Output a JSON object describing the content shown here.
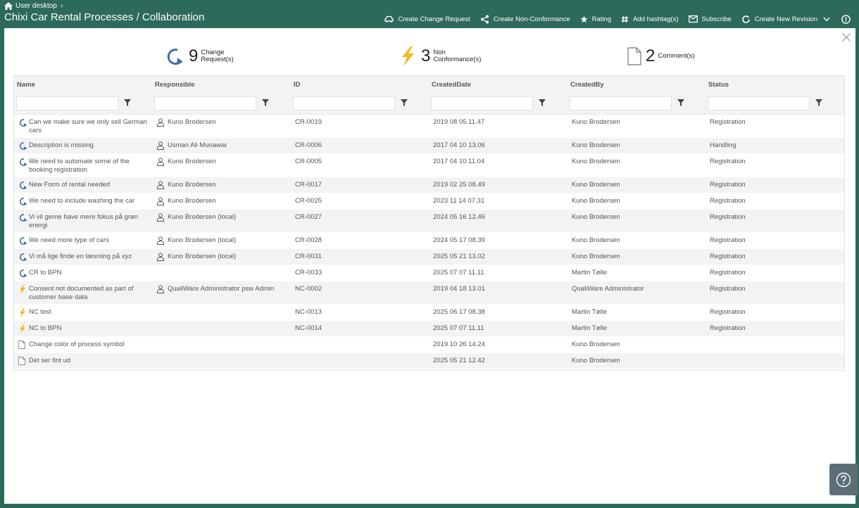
{
  "breadcrumb": {
    "label": "User desktop"
  },
  "title": "Chixi Car Rental Processes / Collaboration",
  "toolbar": {
    "create_change_request": "Create Change Request",
    "create_non_conformance": "Create Non-Conformance",
    "rating": "Rating",
    "add_hashtag": "Add hashtag(s)",
    "subscribe": "Subscribe",
    "create_new_revision": "Create New Revision"
  },
  "summary": {
    "change_requests": {
      "count": "9",
      "label_line1": "Change",
      "label_line2": "Request(s)"
    },
    "non_conformances": {
      "count": "3",
      "label_line1": "Non",
      "label_line2": "Conformance(s)"
    },
    "comments": {
      "count": "2",
      "label": "Comment(s)"
    }
  },
  "columns": {
    "name": "Name",
    "responsible": "Responsible",
    "id": "ID",
    "created_date": "CreatedDate",
    "created_by": "CreatedBy",
    "status": "Status"
  },
  "rows": [
    {
      "type": "change-request",
      "name": "Can we make sure we only sell German cars",
      "responsible": "Kuno Brodersen",
      "id": "CR-0019",
      "date": "2019 08 05 11.47",
      "by": "Kuno Brodersen",
      "status": "Registration"
    },
    {
      "type": "change-request",
      "name": "Description is missing",
      "responsible": "Usman Ali Munawar",
      "id": "CR-0006",
      "date": "2017 04 10 13.06",
      "by": "Kuno Brodersen",
      "status": "Handling"
    },
    {
      "type": "change-request",
      "name": "We need to automate some of the booking registration",
      "responsible": "Kuno Brodersen",
      "id": "CR-0005",
      "date": "2017 04 10 11.04",
      "by": "Kuno Brodersen",
      "status": "Registration"
    },
    {
      "type": "change-request",
      "name": "New Form of rental needed",
      "responsible": "Kuno Brodersen",
      "id": "CR-0017",
      "date": "2019 02 25 08.49",
      "by": "Kuno Brodersen",
      "status": "Registration"
    },
    {
      "type": "change-request",
      "name": "We need to include washing the car",
      "responsible": "Kuno Brodersen",
      "id": "CR-0025",
      "date": "2023 11 14 07.31",
      "by": "Kuno Brodersen",
      "status": "Registration"
    },
    {
      "type": "change-request",
      "name": "Vi vil gerne have mere fokus på grøn energi",
      "responsible": "Kuno Brodersen (local)",
      "id": "CR-0027",
      "date": "2024 05 16 12.46",
      "by": "Kuno Brodersen",
      "status": "Registration"
    },
    {
      "type": "change-request",
      "name": "We need more type of cars",
      "responsible": "Kuno Brodersen (local)",
      "id": "CR-0028",
      "date": "2024 05 17 08.39",
      "by": "Kuno Brodersen",
      "status": "Registration"
    },
    {
      "type": "change-request",
      "name": "Vi må lige finde en læsniing på xyz",
      "responsible": "Kuno Brodersen (local)",
      "id": "CR-0031",
      "date": "2025 05 21 13.02",
      "by": "Kuno Brodersen",
      "status": "Registration"
    },
    {
      "type": "change-request",
      "name": "CR to BPN",
      "responsible": "",
      "id": "CR-0033",
      "date": "2025 07 07 11.11",
      "by": "Martin Tølle",
      "status": "Registration"
    },
    {
      "type": "non-conformance",
      "name": "Consent not documented as part of customer base data",
      "responsible": "QualiWare Administrator psw Admin",
      "id": "NC-0002",
      "date": "2019 04 18 13.01",
      "by": "QualiWare Administrator",
      "status": "Registration"
    },
    {
      "type": "non-conformance",
      "name": "NC test",
      "responsible": "",
      "id": "NC-0013",
      "date": "2025 06 17 08.38",
      "by": "Martin Tølle",
      "status": "Registration"
    },
    {
      "type": "non-conformance",
      "name": "NC to BPN",
      "responsible": "",
      "id": "NC-0014",
      "date": "2025 07 07 11.11",
      "by": "Martin Tølle",
      "status": "Registration"
    },
    {
      "type": "comment",
      "name": "Change color of process symbol",
      "responsible": "",
      "id": "",
      "date": "2019 10 26 14.24",
      "by": "Kuno Brodersen",
      "status": ""
    },
    {
      "type": "comment",
      "name": "Det ser fint ud",
      "responsible": "",
      "id": "",
      "date": "2025 05 21 12.42",
      "by": "Kuno Brodersen",
      "status": ""
    }
  ],
  "colors": {
    "header_bg": "#2d6a5b",
    "row_alt_bg": "#f3f3f3",
    "cr_icon": "#3a6ea8",
    "nc_icon": "#f2b820",
    "help_bg": "#5c6f79"
  }
}
